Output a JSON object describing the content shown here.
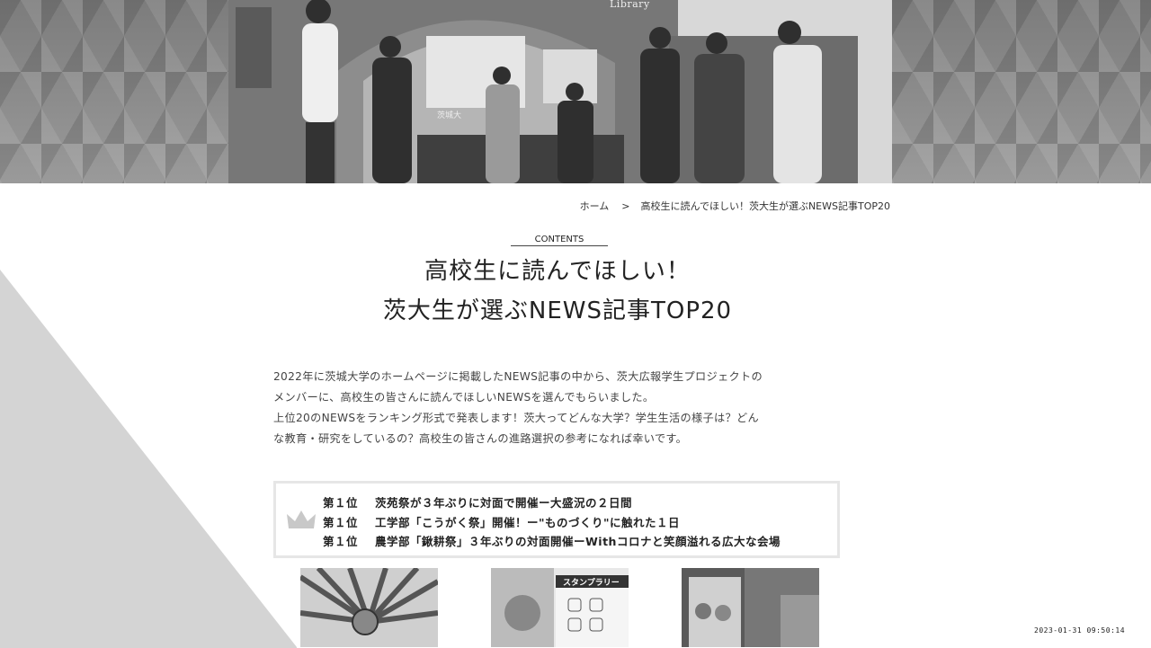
{
  "hero": {
    "library_sign": "Library",
    "building_sign": "茨城大"
  },
  "breadcrumb": {
    "home": "ホーム",
    "separator": ">",
    "current": "高校生に読んでほしい！茨大生が選ぶNEWS記事TOP20"
  },
  "heading": {
    "label": "CONTENTS",
    "title_line1": "高校生に読んでほしい！",
    "title_line2": "茨大生が選ぶNEWS記事TOP20"
  },
  "intro": {
    "line1": "2022年に茨城大学のホームページに掲載したNEWS記事の中から、茨大広報学生プロジェクトの",
    "line2": "メンバーに、高校生の皆さんに読んでほしいNEWSを選んでもらいました。",
    "line3": "上位20のNEWSをランキング形式で発表します！茨大ってどんな大学？学生生活の様子は？どん",
    "line4": "な教育・研究をしているの？高校生の皆さんの進路選択の参考になれば幸いです。"
  },
  "ranking": {
    "items": [
      {
        "position": "第１位",
        "title": "茨苑祭が３年ぶりに対面で開催ー大盛況の２日間"
      },
      {
        "position": "第１位",
        "title": "工学部「こうがく祭」開催！ー\"ものづくり\"に触れた１日"
      },
      {
        "position": "第１位",
        "title": "農学部「鍬耕祭」３年ぶりの対面開催ーWithコロナと笑顔溢れる広大な会場"
      }
    ]
  },
  "thumbnails": [
    {
      "icon": "parasol-photo"
    },
    {
      "icon": "stamp-rally-photo",
      "caption": "スタンプラリー"
    },
    {
      "icon": "festival-poster-photo"
    }
  ],
  "timestamp": "2023-01-31 09:50:14",
  "colors": {
    "text": "#333333",
    "border": "#e6e6e6",
    "background": "#ffffff"
  }
}
